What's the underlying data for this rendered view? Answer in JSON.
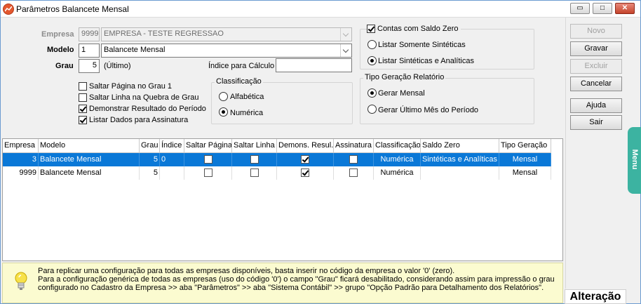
{
  "window": {
    "title": "Parâmetros Balancete Mensal",
    "controls": {
      "minimize": "▭",
      "maximize": "□",
      "close": "✕"
    }
  },
  "form": {
    "empresa": {
      "label": "Empresa",
      "code": "9999",
      "name": "EMPRESA - TESTE REGRESSAO"
    },
    "modelo": {
      "label": "Modelo",
      "code": "1",
      "name": "Balancete Mensal"
    },
    "grau": {
      "label": "Grau",
      "value": "5",
      "note": "(Último)"
    },
    "indice": {
      "label": "Índice para Cálculo",
      "value": ""
    },
    "checks": [
      {
        "label": "Saltar Página no Grau 1",
        "checked": false
      },
      {
        "label": "Saltar Linha na Quebra de Grau",
        "checked": false
      },
      {
        "label": "Demonstrar Resultado do Período",
        "checked": true
      },
      {
        "label": "Listar Dados para Assinatura",
        "checked": true
      }
    ],
    "classificacao": {
      "title": "Classificação",
      "options": [
        {
          "label": "Alfabética",
          "selected": false
        },
        {
          "label": "Numérica",
          "selected": true
        }
      ]
    },
    "saldo": {
      "label": "Contas com Saldo Zero",
      "checked": true,
      "options": [
        {
          "label": "Listar Somente Sintéticas",
          "selected": false
        },
        {
          "label": "Listar Sintéticas e Analíticas",
          "selected": true
        }
      ]
    },
    "tipo_geracao": {
      "title": "Tipo Geração Relatório",
      "options": [
        {
          "label": "Gerar Mensal",
          "selected": true
        },
        {
          "label": "Gerar Último Mês do Período",
          "selected": false
        }
      ]
    }
  },
  "buttons": {
    "novo": "Novo",
    "gravar": "Gravar",
    "excluir": "Excluir",
    "cancelar": "Cancelar",
    "ajuda": "Ajuda",
    "sair": "Sair"
  },
  "menu_tab": "Menu",
  "grid": {
    "columns": [
      "Empresa",
      "Modelo",
      "Grau",
      "Índice",
      "Saltar Página",
      "Saltar Linha",
      "Demons. Resul.",
      "Assinatura",
      "Classificação",
      "Saldo Zero",
      "Tipo Geração"
    ],
    "rows": [
      {
        "empresa": "3",
        "modelo": "Balancete Mensal",
        "grau": "5",
        "indice": "0",
        "saltar_pagina": false,
        "saltar_linha": false,
        "demons_resul": true,
        "assinatura": false,
        "classificacao": "Numérica",
        "saldo_zero": "Sintéticas e Analíticas",
        "tipo_geracao": "Mensal",
        "selected": true
      },
      {
        "empresa": "9999",
        "modelo": "Balancete Mensal",
        "grau": "5",
        "indice": "",
        "saltar_pagina": false,
        "saltar_linha": false,
        "demons_resul": true,
        "assinatura": false,
        "classificacao": "Numérica",
        "saldo_zero": "",
        "tipo_geracao": "Mensal",
        "selected": false
      }
    ]
  },
  "info": {
    "line1": "Para replicar uma configuração para todas as empresas disponíveis, basta inserir no código da empresa o valor '0' (zero).",
    "line2": "Para a configuração genérica de todas as empresas (uso do código '0') o campo \"Grau\" ficará desabilitado, considerando assim para impressão o grau configurado no Cadastro da Empresa >> aba \"Parâmetros\" >> aba \"Sistema Contábil\" >> grupo \"Opção Padrão para Detalhamento dos Relatórios\"."
  },
  "status": "Alteração",
  "colors": {
    "accent": "#0a78d7",
    "menu_tab": "#3cb3a1",
    "info_bg": "#fbfbd0"
  }
}
